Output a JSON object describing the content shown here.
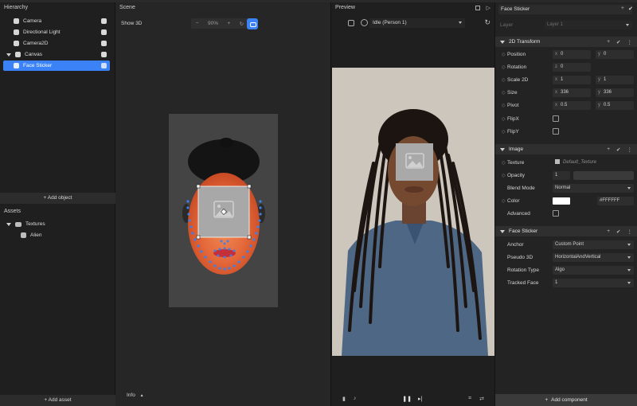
{
  "hierarchy": {
    "title": "Hierarchy",
    "items": [
      {
        "label": "Camera"
      },
      {
        "label": "Directional Light"
      },
      {
        "label": "Camera2D"
      },
      {
        "label": "Canvas"
      },
      {
        "label": "Face Sticker"
      }
    ],
    "add_object": "+ Add object"
  },
  "assets": {
    "title": "Assets",
    "folder": "Textures",
    "items": [
      {
        "label": "Alien"
      }
    ],
    "add_asset": "+ Add asset"
  },
  "scene": {
    "title": "Scene",
    "show3d": "Show 3D",
    "zoom": "90%",
    "info": "Info"
  },
  "preview": {
    "title": "Preview",
    "select_value": "Idle (Person 1)"
  },
  "inspector": {
    "object_name": "Face Sticker",
    "layer_label": "Layer",
    "layer_value": "Layer 1",
    "transform": {
      "title": "2D Transform",
      "position": {
        "label": "Position",
        "x": "0",
        "y": "0"
      },
      "rotation": {
        "label": "Rotation",
        "z": "0"
      },
      "scale": {
        "label": "Scale 2D",
        "x": "1",
        "y": "1"
      },
      "size": {
        "label": "Size",
        "x": "336",
        "y": "336"
      },
      "pivot": {
        "label": "Pivot",
        "x": "0.5",
        "y": "0.5"
      },
      "flipx": "FlipX",
      "flipy": "FlipY"
    },
    "image": {
      "title": "Image",
      "texture_label": "Texture",
      "texture_value": "Default_Texture",
      "opacity_label": "Opacity",
      "opacity_value": "1",
      "blend_label": "Blend Mode",
      "blend_value": "Normal",
      "color_label": "Color",
      "color_hex": "#FFFFFF",
      "advanced_label": "Advanced"
    },
    "face_sticker": {
      "title": "Face Sticker",
      "anchor_label": "Anchor",
      "anchor_value": "Custom Point",
      "pseudo_label": "Pseudo 3D",
      "pseudo_value": "HorizontalAndVertical",
      "rotation_label": "Rotation Type",
      "rotation_value": "Algo",
      "tracked_label": "Tracked Face",
      "tracked_value": "1"
    },
    "add_component": "Add component"
  },
  "colors": {
    "accent": "#3b82f6",
    "panel": "#1f1f1f",
    "scene_bg": "#262626"
  }
}
